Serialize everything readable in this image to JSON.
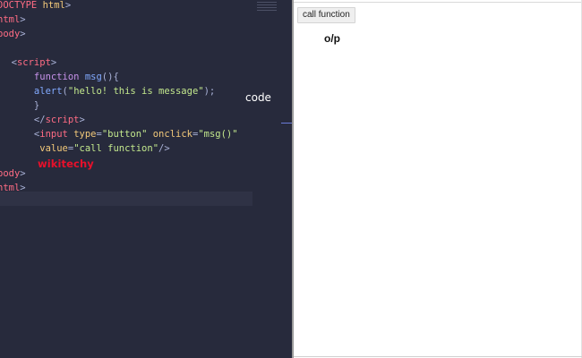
{
  "editor": {
    "lines": [
      {
        "parts": [
          {
            "c": "tag",
            "t": "DOCTYPE "
          },
          {
            "c": "attr",
            "t": "html"
          },
          {
            "c": "punc",
            "t": ">"
          }
        ]
      },
      {
        "parts": [
          {
            "c": "tag",
            "t": "html"
          },
          {
            "c": "punc",
            "t": ">"
          }
        ]
      },
      {
        "parts": [
          {
            "c": "tag",
            "t": "body"
          },
          {
            "c": "punc",
            "t": ">"
          }
        ]
      },
      {
        "parts": []
      },
      {
        "parts": [
          {
            "c": "punc",
            "t": "  <"
          },
          {
            "c": "tag",
            "t": "script"
          },
          {
            "c": "punc",
            "t": ">"
          }
        ]
      },
      {
        "parts": [
          {
            "c": "kw",
            "t": "      function "
          },
          {
            "c": "fn",
            "t": "msg"
          },
          {
            "c": "punc",
            "t": "(){"
          }
        ]
      },
      {
        "parts": [
          {
            "c": "fn",
            "t": "      alert"
          },
          {
            "c": "punc",
            "t": "("
          },
          {
            "c": "str",
            "t": "\"hello! this is message\""
          },
          {
            "c": "punc",
            "t": ");"
          }
        ]
      },
      {
        "parts": [
          {
            "c": "punc",
            "t": "      }"
          }
        ]
      },
      {
        "parts": [
          {
            "c": "punc",
            "t": "      </"
          },
          {
            "c": "tag",
            "t": "script"
          },
          {
            "c": "punc",
            "t": ">"
          }
        ]
      },
      {
        "parts": [
          {
            "c": "punc",
            "t": "      <"
          },
          {
            "c": "tag",
            "t": "input "
          },
          {
            "c": "attr",
            "t": "type"
          },
          {
            "c": "punc",
            "t": "="
          },
          {
            "c": "str",
            "t": "\"button\" "
          },
          {
            "c": "attr",
            "t": "onclick"
          },
          {
            "c": "punc",
            "t": "="
          },
          {
            "c": "str",
            "t": "\"msg()\""
          }
        ]
      },
      {
        "parts": [
          {
            "c": "attr",
            "t": "       value"
          },
          {
            "c": "punc",
            "t": "="
          },
          {
            "c": "str",
            "t": "\"call function\""
          },
          {
            "c": "punc",
            "t": "/>"
          }
        ]
      },
      {
        "parts": []
      },
      {
        "parts": [
          {
            "c": "tag",
            "t": "body"
          },
          {
            "c": "punc",
            "t": ">"
          }
        ]
      },
      {
        "parts": [
          {
            "c": "tag",
            "t": "html"
          },
          {
            "c": "punc",
            "t": ">"
          }
        ]
      }
    ],
    "watermark": "wikitechy",
    "code_label": "code"
  },
  "output": {
    "button_label": "call function",
    "op_label": "o/p"
  },
  "colors": {
    "editor_bg": "#272a3c",
    "tag": "#ff6c84",
    "attr": "#f3c97a",
    "string": "#c3e88d",
    "keyword": "#c792ea",
    "function": "#82aaff",
    "watermark": "#e8102b"
  }
}
